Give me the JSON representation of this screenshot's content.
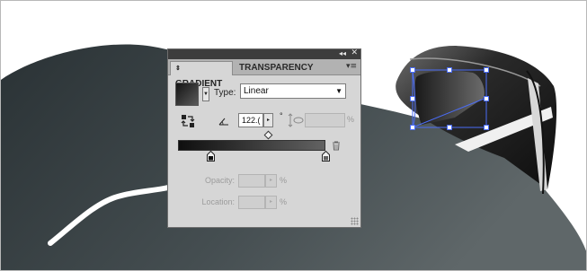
{
  "panel": {
    "titlebar": {
      "collapse_glyph": "◂◂",
      "close_glyph": "✕"
    },
    "tabs": [
      {
        "label": "GRADIENT",
        "active": true
      },
      {
        "label": "TRANSPARENCY",
        "active": false
      }
    ],
    "tab_caret": "⇕",
    "menu_glyph": "▾≡",
    "type_label": "Type:",
    "type_value": "Linear",
    "select_arrow": "▼",
    "angle_value": "122.(",
    "angle_stepper_glyph": "▸",
    "degree_symbol": "°",
    "aspect_percent": "%",
    "opacity_label": "Opacity:",
    "location_label": "Location:",
    "opacity_percent": "%",
    "location_percent": "%",
    "stepper_glyph": "▸",
    "gradient_start_color": "#0f0f0f",
    "gradient_end_color": "#626262"
  },
  "icons": [
    "reverse-gradient-icon",
    "angle-icon",
    "aspect-ratio-icon",
    "trash-icon",
    "gradient-stop-icon",
    "midpoint-diamond-icon"
  ]
}
